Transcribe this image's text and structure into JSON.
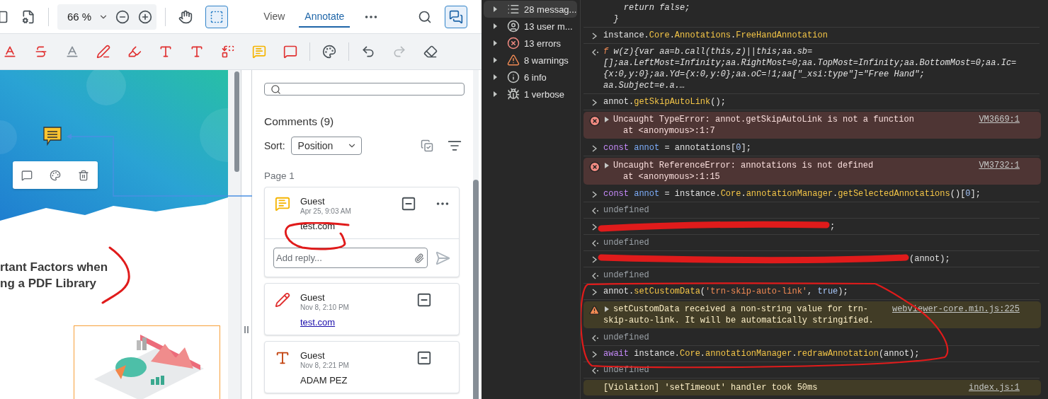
{
  "viewer": {
    "header": {
      "zoom": "66 %",
      "tools": [
        {
          "kind": "pan",
          "active": false
        },
        {
          "kind": "select",
          "active": true
        }
      ],
      "tabs": [
        {
          "label": "View",
          "selected": false
        },
        {
          "label": "Annotate",
          "selected": true
        }
      ],
      "panel_toggle": {
        "active": true
      }
    },
    "toolbar": {
      "groups": [
        [
          {
            "kind": "underline",
            "disabled": false
          },
          {
            "kind": "strikeout",
            "disabled": false
          },
          {
            "kind": "squiggly",
            "disabled": false
          },
          {
            "kind": "freehand",
            "disabled": false
          },
          {
            "kind": "freehighlight",
            "disabled": false
          },
          {
            "kind": "freetext",
            "disabled": false
          },
          {
            "kind": "inserttext",
            "disabled": false
          },
          {
            "kind": "replacetext",
            "disabled": false
          },
          {
            "kind": "stickynote",
            "disabled": false
          },
          {
            "kind": "callout",
            "disabled": false
          }
        ],
        [
          {
            "kind": "palette",
            "disabled": false
          }
        ],
        [
          {
            "kind": "undo",
            "disabled": false
          },
          {
            "kind": "redo",
            "disabled": true
          },
          {
            "kind": "eraser",
            "disabled": false
          }
        ]
      ]
    },
    "document": {
      "heading": [
        "rtant Factors when",
        "ng a PDF Library"
      ]
    },
    "comments": {
      "title": "Comments (9)",
      "sort_label": "Sort:",
      "sort_value": "Position",
      "page_label": "Page 1",
      "cards": [
        {
          "kind": "note",
          "author": "Guest",
          "date": "Apr 25, 9:03 AM",
          "text": "test.com",
          "is_link": false,
          "expanded": true,
          "reply_placeholder": "Add reply..."
        },
        {
          "kind": "freehand",
          "author": "Guest",
          "date": "Nov 8, 2:10 PM",
          "text": "test.com",
          "is_link": true,
          "expanded": false
        },
        {
          "kind": "freetext",
          "author": "Guest",
          "date": "Nov 8, 2:21 PM",
          "text": "ADAM PEZ",
          "is_link": false,
          "expanded": false
        }
      ]
    }
  },
  "devtools": {
    "sidebar": [
      {
        "kind": "messages",
        "label": "28 messag...",
        "selected": true
      },
      {
        "kind": "user",
        "label": "13 user m...",
        "selected": false
      },
      {
        "kind": "errors",
        "label": "13 errors",
        "selected": false
      },
      {
        "kind": "warnings",
        "label": "8 warnings",
        "selected": false
      },
      {
        "kind": "info",
        "label": "6 info",
        "selected": false
      },
      {
        "kind": "verbose",
        "label": "1 verbose",
        "selected": false
      }
    ],
    "console": [
      {
        "kind": "continuation",
        "lines": [
          [
            {
              "kind": "italic",
              "text": "    return false;"
            }
          ],
          [
            {
              "kind": "italic",
              "text": "  }"
            }
          ]
        ]
      },
      {
        "kind": "input",
        "lines": [
          [
            {
              "kind": "plain",
              "text": "instance."
            },
            {
              "kind": "prop",
              "text": "Core"
            },
            {
              "kind": "plain",
              "text": "."
            },
            {
              "kind": "prop",
              "text": "Annotations"
            },
            {
              "kind": "plain",
              "text": "."
            },
            {
              "kind": "prop",
              "text": "FreeHandAnnotation"
            }
          ]
        ]
      },
      {
        "kind": "result",
        "lines": [
          [
            {
              "kind": "fn",
              "text": "f"
            },
            {
              "kind": "italic",
              "text": " w(z){var aa=b.call(this,z)||this;aa.sb="
            }
          ],
          [
            {
              "kind": "italic",
              "text": "[];aa.LeftMost=Infinity;aa.RightMost=0;aa.TopMost=Infinity;aa.BottomMost=0;aa.Ic="
            }
          ],
          [
            {
              "kind": "italic",
              "text": "{x:0,y:0};aa.Yd={x:0,y:0};aa.oC=!1;aa[\"_xsi:type\"]=\"Free Hand\";"
            }
          ],
          [
            {
              "kind": "italic",
              "text": "aa.Subject=e.a.…"
            }
          ]
        ]
      },
      {
        "kind": "input",
        "lines": [
          [
            {
              "kind": "plain",
              "text": "annot."
            },
            {
              "kind": "prop",
              "text": "getSkipAutoLink"
            },
            {
              "kind": "plain",
              "text": "();"
            }
          ]
        ]
      },
      {
        "kind": "error",
        "source": "VM3669:1",
        "lines": [
          [
            {
              "kind": "plain",
              "text": "Uncaught TypeError: annot.getSkipAutoLink is not a function"
            }
          ],
          [
            {
              "kind": "plain",
              "text": "at <anonymous>:1:7"
            }
          ]
        ]
      },
      {
        "kind": "input",
        "lines": [
          [
            {
              "kind": "keyword",
              "text": "const "
            },
            {
              "kind": "var",
              "text": "annot"
            },
            {
              "kind": "plain",
              "text": " = annotations["
            },
            {
              "kind": "num",
              "text": "0"
            },
            {
              "kind": "plain",
              "text": "];"
            }
          ]
        ]
      },
      {
        "kind": "error",
        "source": "VM3732:1",
        "lines": [
          [
            {
              "kind": "plain",
              "text": "Uncaught ReferenceError: annotations is not defined"
            }
          ],
          [
            {
              "kind": "plain",
              "text": "at <anonymous>:1:15"
            }
          ]
        ]
      },
      {
        "kind": "input",
        "lines": [
          [
            {
              "kind": "keyword",
              "text": "const "
            },
            {
              "kind": "var",
              "text": "annot"
            },
            {
              "kind": "plain",
              "text": " = instance."
            },
            {
              "kind": "prop",
              "text": "Core"
            },
            {
              "kind": "plain",
              "text": "."
            },
            {
              "kind": "prop",
              "text": "annotationManager"
            },
            {
              "kind": "plain",
              "text": "."
            },
            {
              "kind": "prop",
              "text": "getSelectedAnnotations"
            },
            {
              "kind": "plain",
              "text": "()["
            },
            {
              "kind": "num",
              "text": "0"
            },
            {
              "kind": "plain",
              "text": "];"
            }
          ]
        ]
      },
      {
        "kind": "result",
        "lines": [
          [
            {
              "kind": "muted",
              "text": "undefined"
            }
          ]
        ]
      },
      {
        "kind": "redacted",
        "lines": [
          [
            {
              "kind": "plain",
              "text": ";"
            }
          ]
        ]
      },
      {
        "kind": "result",
        "lines": [
          [
            {
              "kind": "muted",
              "text": "undefined"
            }
          ]
        ]
      },
      {
        "kind": "redacted",
        "lines": [
          [
            {
              "kind": "plain",
              "text": "(annot);"
            }
          ]
        ]
      },
      {
        "kind": "result",
        "lines": [
          [
            {
              "kind": "muted",
              "text": "undefined"
            }
          ]
        ]
      },
      {
        "kind": "input",
        "lines": [
          [
            {
              "kind": "plain",
              "text": "annot."
            },
            {
              "kind": "prop",
              "text": "setCustomData"
            },
            {
              "kind": "plain",
              "text": "("
            },
            {
              "kind": "string",
              "text": "'trn-skip-auto-link'"
            },
            {
              "kind": "plain",
              "text": ", "
            },
            {
              "kind": "num",
              "text": "true"
            },
            {
              "kind": "plain",
              "text": ");"
            }
          ]
        ]
      },
      {
        "kind": "warning",
        "source": "webviewer-core.min.js:225",
        "lines": [
          [
            {
              "kind": "plain",
              "text": "setCustomData received a non-string value for trn-skip-auto-link. It will be automatically stringified."
            }
          ]
        ]
      },
      {
        "kind": "result",
        "lines": [
          [
            {
              "kind": "muted",
              "text": "undefined"
            }
          ]
        ]
      },
      {
        "kind": "input",
        "lines": [
          [
            {
              "kind": "keyword",
              "text": "await"
            },
            {
              "kind": "plain",
              "text": " instance."
            },
            {
              "kind": "prop",
              "text": "Core"
            },
            {
              "kind": "plain",
              "text": "."
            },
            {
              "kind": "prop",
              "text": "annotationManager"
            },
            {
              "kind": "plain",
              "text": "."
            },
            {
              "kind": "prop",
              "text": "redrawAnnotation"
            },
            {
              "kind": "plain",
              "text": "(annot);"
            }
          ]
        ]
      },
      {
        "kind": "result",
        "lines": [
          [
            {
              "kind": "muted",
              "text": "undefined"
            }
          ]
        ]
      },
      {
        "kind": "violation",
        "source": "index.js:1",
        "lines": [
          [
            {
              "kind": "plain",
              "text": "[Violation] 'setTimeout' handler took 50ms"
            }
          ]
        ]
      }
    ]
  }
}
